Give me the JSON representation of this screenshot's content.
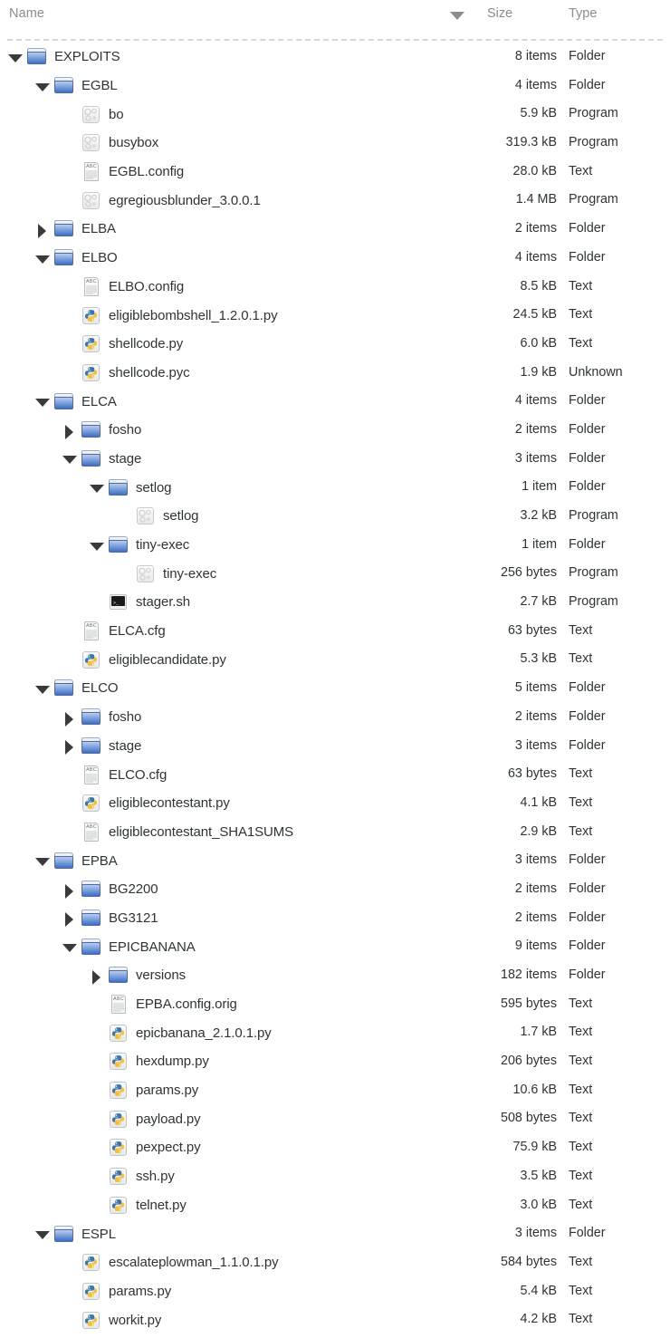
{
  "header": {
    "name_label": "Name",
    "size_label": "Size",
    "type_label": "Type",
    "sort_icon": "sort-descending-icon",
    "sort_column": "Name",
    "sort_direction": "descending"
  },
  "colors": {
    "folder_blue": "#3f6fc4",
    "header_text": "#8a8e8f",
    "row_text": "#2e3436",
    "separator": "#d3d7d8",
    "background": "#ffffff"
  },
  "rows": [
    {
      "name": "EXPLOITS",
      "size": "8 items",
      "type": "Folder",
      "depth": 0,
      "icon": "folder-icon",
      "expander": "open"
    },
    {
      "name": "EGBL",
      "size": "4 items",
      "type": "Folder",
      "depth": 1,
      "icon": "folder-icon",
      "expander": "open"
    },
    {
      "name": "bo",
      "size": "5.9 kB",
      "type": "Program",
      "depth": 2,
      "icon": "program-icon",
      "expander": "none"
    },
    {
      "name": "busybox",
      "size": "319.3 kB",
      "type": "Program",
      "depth": 2,
      "icon": "program-icon",
      "expander": "none"
    },
    {
      "name": "EGBL.config",
      "size": "28.0 kB",
      "type": "Text",
      "depth": 2,
      "icon": "text-icon",
      "expander": "none"
    },
    {
      "name": "egregiousblunder_3.0.0.1",
      "size": "1.4 MB",
      "type": "Program",
      "depth": 2,
      "icon": "program-icon",
      "expander": "none"
    },
    {
      "name": "ELBA",
      "size": "2 items",
      "type": "Folder",
      "depth": 1,
      "icon": "folder-icon",
      "expander": "closed"
    },
    {
      "name": "ELBO",
      "size": "4 items",
      "type": "Folder",
      "depth": 1,
      "icon": "folder-icon",
      "expander": "open"
    },
    {
      "name": "ELBO.config",
      "size": "8.5 kB",
      "type": "Text",
      "depth": 2,
      "icon": "text-icon",
      "expander": "none"
    },
    {
      "name": "eligiblebombshell_1.2.0.1.py",
      "size": "24.5 kB",
      "type": "Text",
      "depth": 2,
      "icon": "python-icon",
      "expander": "none"
    },
    {
      "name": "shellcode.py",
      "size": "6.0 kB",
      "type": "Text",
      "depth": 2,
      "icon": "python-icon",
      "expander": "none"
    },
    {
      "name": "shellcode.pyc",
      "size": "1.9 kB",
      "type": "Unknown",
      "depth": 2,
      "icon": "python-icon",
      "expander": "none"
    },
    {
      "name": "ELCA",
      "size": "4 items",
      "type": "Folder",
      "depth": 1,
      "icon": "folder-icon",
      "expander": "open"
    },
    {
      "name": "fosho",
      "size": "2 items",
      "type": "Folder",
      "depth": 2,
      "icon": "folder-icon",
      "expander": "closed"
    },
    {
      "name": "stage",
      "size": "3 items",
      "type": "Folder",
      "depth": 2,
      "icon": "folder-icon",
      "expander": "open"
    },
    {
      "name": "setlog",
      "size": "1 item",
      "type": "Folder",
      "depth": 3,
      "icon": "folder-icon",
      "expander": "open"
    },
    {
      "name": "setlog",
      "size": "3.2 kB",
      "type": "Program",
      "depth": 4,
      "icon": "program-icon",
      "expander": "none"
    },
    {
      "name": "tiny-exec",
      "size": "1 item",
      "type": "Folder",
      "depth": 3,
      "icon": "folder-icon",
      "expander": "open"
    },
    {
      "name": "tiny-exec",
      "size": "256 bytes",
      "type": "Program",
      "depth": 4,
      "icon": "program-icon",
      "expander": "none"
    },
    {
      "name": "stager.sh",
      "size": "2.7 kB",
      "type": "Program",
      "depth": 3,
      "icon": "terminal-icon",
      "expander": "none"
    },
    {
      "name": "ELCA.cfg",
      "size": "63 bytes",
      "type": "Text",
      "depth": 2,
      "icon": "text-icon",
      "expander": "none"
    },
    {
      "name": "eligiblecandidate.py",
      "size": "5.3 kB",
      "type": "Text",
      "depth": 2,
      "icon": "python-icon",
      "expander": "none"
    },
    {
      "name": "ELCO",
      "size": "5 items",
      "type": "Folder",
      "depth": 1,
      "icon": "folder-icon",
      "expander": "open"
    },
    {
      "name": "fosho",
      "size": "2 items",
      "type": "Folder",
      "depth": 2,
      "icon": "folder-icon",
      "expander": "closed"
    },
    {
      "name": "stage",
      "size": "3 items",
      "type": "Folder",
      "depth": 2,
      "icon": "folder-icon",
      "expander": "closed"
    },
    {
      "name": "ELCO.cfg",
      "size": "63 bytes",
      "type": "Text",
      "depth": 2,
      "icon": "text-icon",
      "expander": "none"
    },
    {
      "name": "eligiblecontestant.py",
      "size": "4.1 kB",
      "type": "Text",
      "depth": 2,
      "icon": "python-icon",
      "expander": "none"
    },
    {
      "name": "eligiblecontestant_SHA1SUMS",
      "size": "2.9 kB",
      "type": "Text",
      "depth": 2,
      "icon": "text-icon",
      "expander": "none"
    },
    {
      "name": "EPBA",
      "size": "3 items",
      "type": "Folder",
      "depth": 1,
      "icon": "folder-icon",
      "expander": "open"
    },
    {
      "name": "BG2200",
      "size": "2 items",
      "type": "Folder",
      "depth": 2,
      "icon": "folder-icon",
      "expander": "closed"
    },
    {
      "name": "BG3121",
      "size": "2 items",
      "type": "Folder",
      "depth": 2,
      "icon": "folder-icon",
      "expander": "closed"
    },
    {
      "name": "EPICBANANA",
      "size": "9 items",
      "type": "Folder",
      "depth": 2,
      "icon": "folder-icon",
      "expander": "open"
    },
    {
      "name": "versions",
      "size": "182 items",
      "type": "Folder",
      "depth": 3,
      "icon": "folder-icon",
      "expander": "closed"
    },
    {
      "name": "EPBA.config.orig",
      "size": "595 bytes",
      "type": "Text",
      "depth": 3,
      "icon": "text-icon",
      "expander": "none"
    },
    {
      "name": "epicbanana_2.1.0.1.py",
      "size": "1.7 kB",
      "type": "Text",
      "depth": 3,
      "icon": "python-icon",
      "expander": "none"
    },
    {
      "name": "hexdump.py",
      "size": "206 bytes",
      "type": "Text",
      "depth": 3,
      "icon": "python-icon",
      "expander": "none"
    },
    {
      "name": "params.py",
      "size": "10.6 kB",
      "type": "Text",
      "depth": 3,
      "icon": "python-icon",
      "expander": "none"
    },
    {
      "name": "payload.py",
      "size": "508 bytes",
      "type": "Text",
      "depth": 3,
      "icon": "python-icon",
      "expander": "none"
    },
    {
      "name": "pexpect.py",
      "size": "75.9 kB",
      "type": "Text",
      "depth": 3,
      "icon": "python-icon",
      "expander": "none"
    },
    {
      "name": "ssh.py",
      "size": "3.5 kB",
      "type": "Text",
      "depth": 3,
      "icon": "python-icon",
      "expander": "none"
    },
    {
      "name": "telnet.py",
      "size": "3.0 kB",
      "type": "Text",
      "depth": 3,
      "icon": "python-icon",
      "expander": "none"
    },
    {
      "name": "ESPL",
      "size": "3 items",
      "type": "Folder",
      "depth": 1,
      "icon": "folder-icon",
      "expander": "open"
    },
    {
      "name": "escalateplowman_1.1.0.1.py",
      "size": "584 bytes",
      "type": "Text",
      "depth": 2,
      "icon": "python-icon",
      "expander": "none"
    },
    {
      "name": "params.py",
      "size": "5.4 kB",
      "type": "Text",
      "depth": 2,
      "icon": "python-icon",
      "expander": "none"
    },
    {
      "name": "workit.py",
      "size": "4.2 kB",
      "type": "Text",
      "depth": 2,
      "icon": "python-icon",
      "expander": "none"
    }
  ]
}
